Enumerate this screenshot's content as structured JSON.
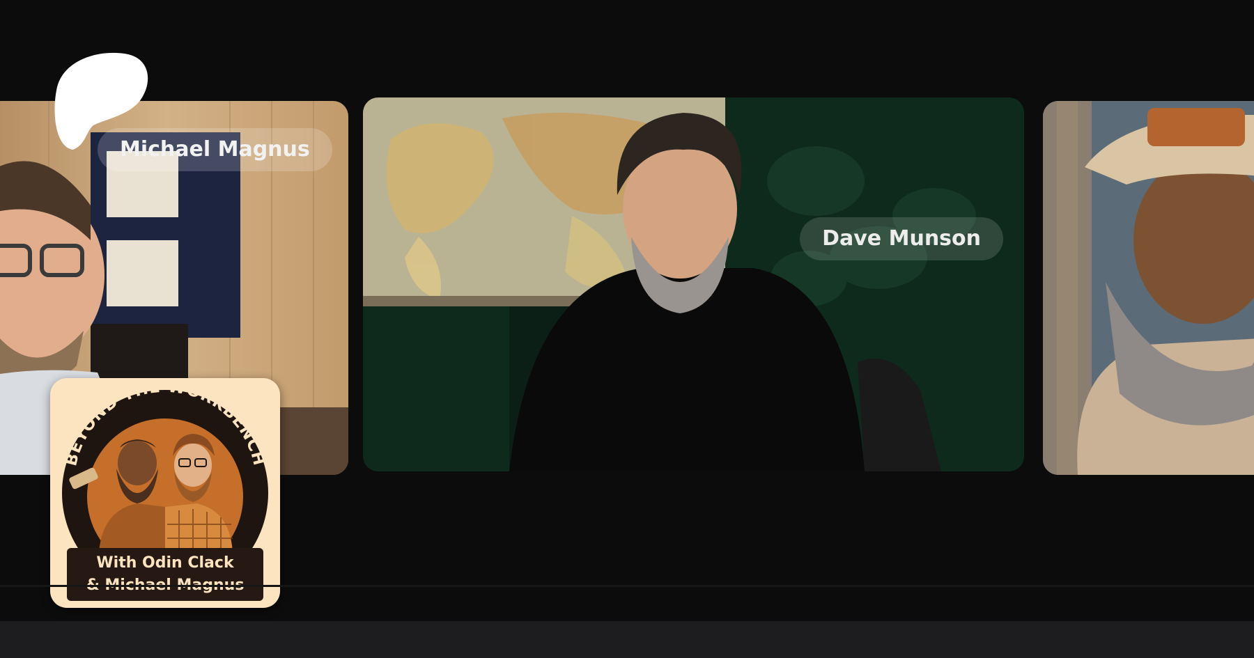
{
  "participants": [
    {
      "name": "Michael Magnus"
    },
    {
      "name": "Dave Munson"
    },
    {
      "name": ""
    }
  ],
  "podcast": {
    "title": "BEYOND THE WORKBENCH",
    "subtitle_line1": "With Odin Clack",
    "subtitle_line2": "& Michael Magnus"
  },
  "icons": {
    "brand": "patreon-logo-icon"
  },
  "colors": {
    "background": "#0c0c0d",
    "bottom_bar": "#1d1d1f",
    "badge_bg": "#fbe4bf",
    "badge_dark": "#261812",
    "badge_orange": "#c56f2b"
  }
}
